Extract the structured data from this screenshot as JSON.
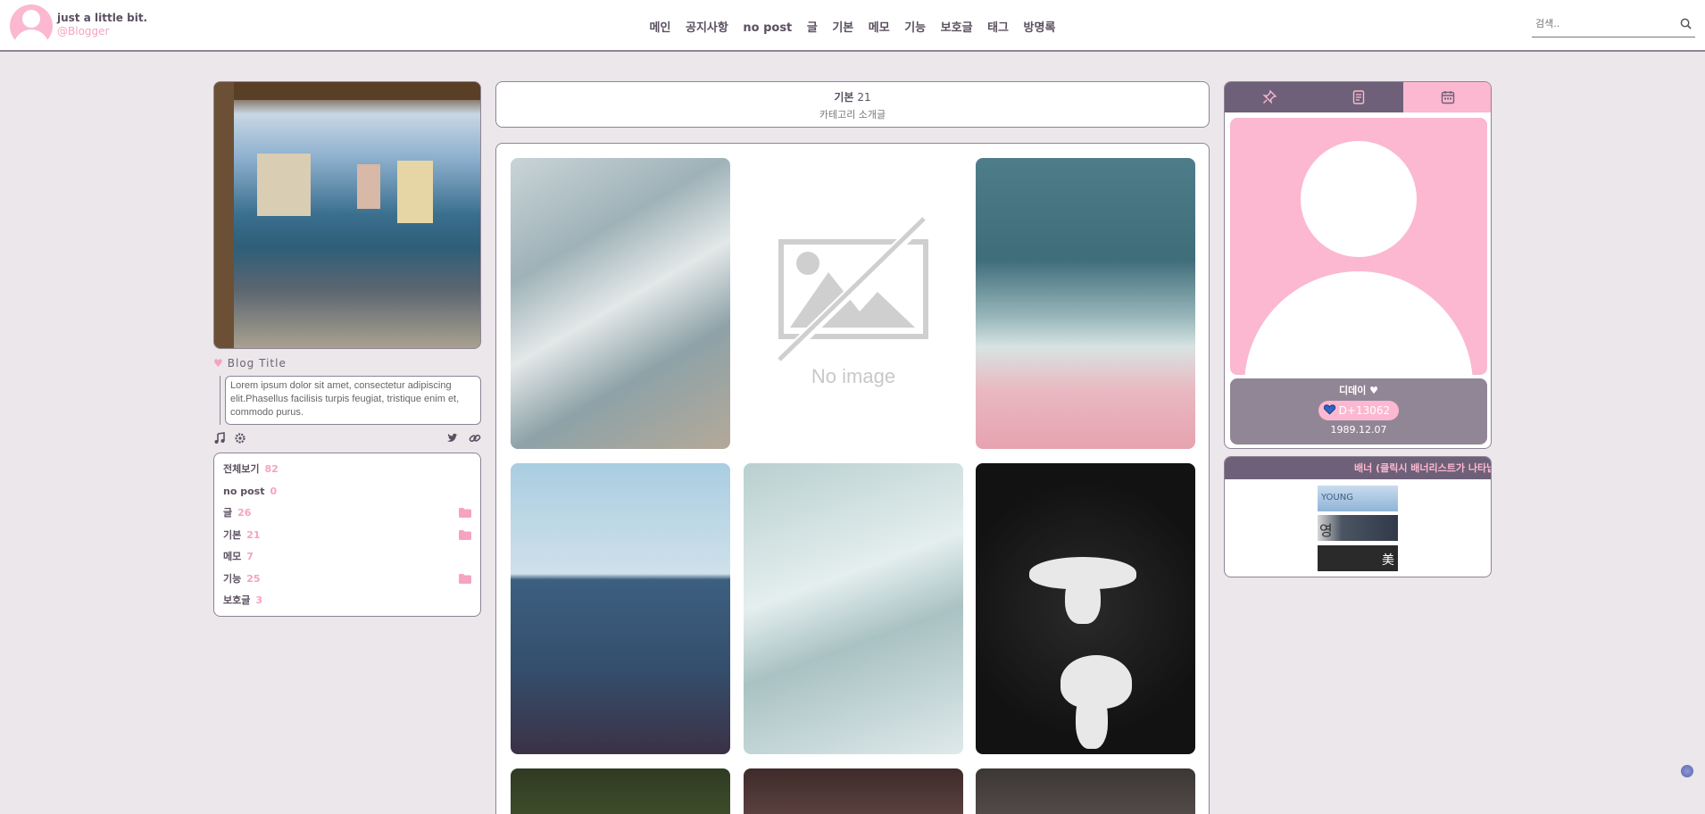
{
  "header": {
    "blog_name": "just a little bit.",
    "user": "@Blogger",
    "nav": [
      "메인",
      "공지사항",
      "no post",
      "글",
      "기본",
      "메모",
      "기능",
      "보호글",
      "태그",
      "방명록"
    ],
    "search_placeholder": "검색.."
  },
  "sidebar": {
    "blog_title": "Blog Title",
    "description": "Lorem ipsum dolor sit amet, consectetur adipiscing elit.Phasellus facilisis turpis feugiat, tristique enim et, commodo purus.",
    "categories": [
      {
        "name": "전체보기",
        "count": "82",
        "folder": false
      },
      {
        "name": "no post",
        "count": "0",
        "folder": false
      },
      {
        "name": "글",
        "count": "26",
        "folder": true
      },
      {
        "name": "기본",
        "count": "21",
        "folder": true
      },
      {
        "name": "메모",
        "count": "7",
        "folder": false
      },
      {
        "name": "기능",
        "count": "25",
        "folder": true
      },
      {
        "name": "보호글",
        "count": "3",
        "folder": false
      }
    ]
  },
  "main": {
    "category_name": "기본",
    "category_count": "21",
    "category_desc": "카테고리 소개글",
    "no_image_text": "No image"
  },
  "right": {
    "dday_title": "디데이",
    "dday_value": "D+13062",
    "dday_date": "1989.12.07",
    "banner_title": "배너 (클릭시 배너리스트가 나타납니다)",
    "banner1_text": "YOUNG",
    "banner2_text": "영",
    "banner3_text": "美"
  },
  "colors": {
    "accent_pink": "#fbb8d0",
    "accent_purple": "#6e6079",
    "background": "#ebe7eb"
  }
}
